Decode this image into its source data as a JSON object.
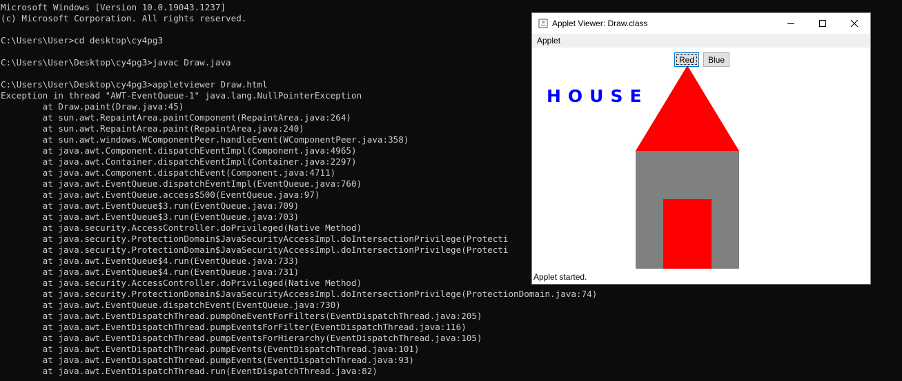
{
  "console": {
    "lines": [
      "Microsoft Windows [Version 10.0.19043.1237]",
      "(c) Microsoft Corporation. All rights reserved.",
      "",
      "C:\\Users\\User>cd desktop\\cy4pg3",
      "",
      "C:\\Users\\User\\Desktop\\cy4pg3>javac Draw.java",
      "",
      "C:\\Users\\User\\Desktop\\cy4pg3>appletviewer Draw.html",
      "Exception in thread \"AWT-EventQueue-1\" java.lang.NullPointerException",
      "        at Draw.paint(Draw.java:45)",
      "        at sun.awt.RepaintArea.paintComponent(RepaintArea.java:264)",
      "        at sun.awt.RepaintArea.paint(RepaintArea.java:240)",
      "        at sun.awt.windows.WComponentPeer.handleEvent(WComponentPeer.java:358)",
      "        at java.awt.Component.dispatchEventImpl(Component.java:4965)",
      "        at java.awt.Container.dispatchEventImpl(Container.java:2297)",
      "        at java.awt.Component.dispatchEvent(Component.java:4711)",
      "        at java.awt.EventQueue.dispatchEventImpl(EventQueue.java:760)",
      "        at java.awt.EventQueue.access$500(EventQueue.java:97)",
      "        at java.awt.EventQueue$3.run(EventQueue.java:709)",
      "        at java.awt.EventQueue$3.run(EventQueue.java:703)",
      "        at java.security.AccessController.doPrivileged(Native Method)",
      "        at java.security.ProtectionDomain$JavaSecurityAccessImpl.doIntersectionPrivilege(Protecti",
      "        at java.security.ProtectionDomain$JavaSecurityAccessImpl.doIntersectionPrivilege(Protecti",
      "        at java.awt.EventQueue$4.run(EventQueue.java:733)",
      "        at java.awt.EventQueue$4.run(EventQueue.java:731)",
      "        at java.security.AccessController.doPrivileged(Native Method)",
      "        at java.security.ProtectionDomain$JavaSecurityAccessImpl.doIntersectionPrivilege(ProtectionDomain.java:74)",
      "        at java.awt.EventQueue.dispatchEvent(EventQueue.java:730)",
      "        at java.awt.EventDispatchThread.pumpOneEventForFilters(EventDispatchThread.java:205)",
      "        at java.awt.EventDispatchThread.pumpEventsForFilter(EventDispatchThread.java:116)",
      "        at java.awt.EventDispatchThread.pumpEventsForHierarchy(EventDispatchThread.java:105)",
      "        at java.awt.EventDispatchThread.pumpEvents(EventDispatchThread.java:101)",
      "        at java.awt.EventDispatchThread.pumpEvents(EventDispatchThread.java:93)",
      "        at java.awt.EventDispatchThread.run(EventDispatchThread.java:82)"
    ]
  },
  "applet_window": {
    "title": "Applet Viewer: Draw.class",
    "app_icon": "java-icon",
    "controls": {
      "minimize_icon": "minimize-icon",
      "maximize_icon": "maximize-icon",
      "close_icon": "close-icon"
    },
    "menu": {
      "applet_label": "Applet"
    },
    "buttons": {
      "red_label": "Red",
      "blue_label": "Blue"
    },
    "drawing": {
      "house_text": "HOUSE",
      "house_text_color": "#0000ff",
      "roof_color": "#ff0000",
      "walls_color": "#808080",
      "door_color": "#ff0000"
    },
    "status": "Applet started."
  },
  "colors": {
    "console_bg": "#0c0c0c",
    "console_fg": "#cccccc"
  }
}
